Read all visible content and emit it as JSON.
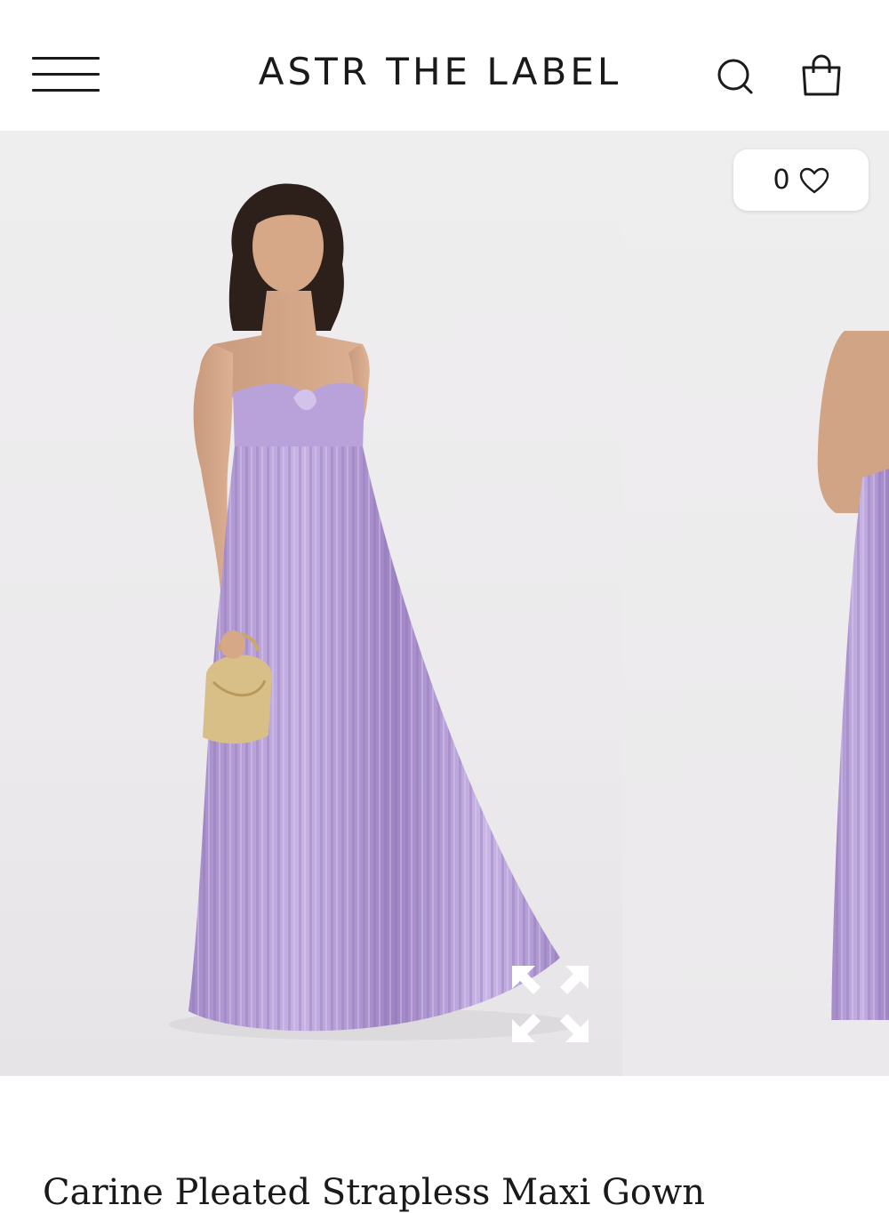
{
  "header": {
    "brand": "ASTR THE LABEL",
    "menu_icon": "hamburger-menu-icon",
    "search_icon": "search-icon",
    "bag_icon": "shopping-bag-icon"
  },
  "gallery": {
    "wishlist_count": "0",
    "wishlist_icon": "heart-outline-icon",
    "expand_icon": "expand-arrows-icon",
    "dress_color": "#b49ad4"
  },
  "product": {
    "title_peek": "Carine Pleated Strapless Maxi Gown"
  }
}
